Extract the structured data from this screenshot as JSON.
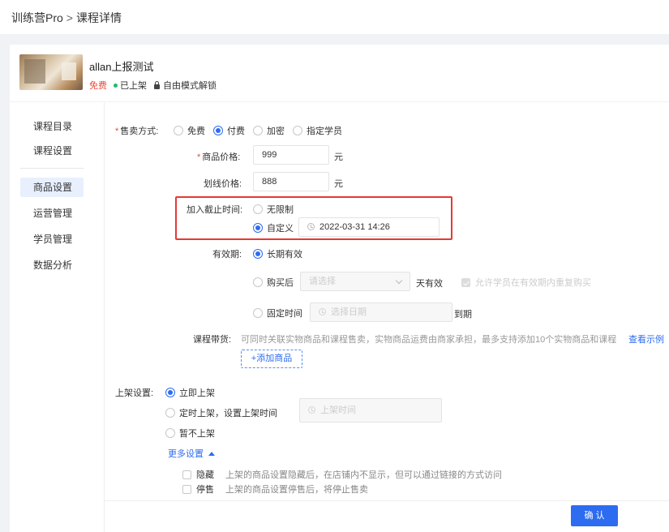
{
  "breadcrumb": {
    "root": "训练营Pro",
    "separator": ">",
    "current": "课程详情"
  },
  "course": {
    "title": "allan上报测试",
    "price_tag": "免费",
    "status": "已上架",
    "lock_mode": "自由模式解锁"
  },
  "sidebar": {
    "items": [
      {
        "label": "课程目录"
      },
      {
        "label": "课程设置"
      },
      {
        "label": "商品设置"
      },
      {
        "label": "运营管理"
      },
      {
        "label": "学员管理"
      },
      {
        "label": "数据分析"
      }
    ],
    "active": "商品设置"
  },
  "sale_method": {
    "label": "售卖方式:",
    "options": [
      {
        "label": "免费",
        "checked": false
      },
      {
        "label": "付费",
        "checked": true
      },
      {
        "label": "加密",
        "checked": false
      },
      {
        "label": "指定学员",
        "checked": false
      }
    ]
  },
  "price": {
    "label": "商品价格:",
    "value": "999",
    "unit": "元"
  },
  "strike_price": {
    "label": "划线价格:",
    "value": "888",
    "unit": "元"
  },
  "join_deadline": {
    "label": "加入截止时间:",
    "option_unlimited": "无限制",
    "option_custom": "自定义",
    "datetime": "2022-03-31 14:26"
  },
  "validity": {
    "label": "有效期:",
    "option_long_term": "长期有效",
    "option_after_purchase": "购买后",
    "select_placeholder": "请选择",
    "days_suffix": "天有效",
    "allow_repurchase": "允许学员在有效期内重复购买",
    "option_fixed_time": "固定时间",
    "date_placeholder": "选择日期",
    "expire_suffix": "到期"
  },
  "bundle": {
    "label": "课程带货:",
    "description": "可同时关联实物商品和课程售卖，实物商品运费由商家承担，最多支持添加10个实物商品和课程",
    "example_link": "查看示例",
    "add_button": "+添加商品"
  },
  "listing": {
    "label": "上架设置:",
    "option_now": "立即上架",
    "option_scheduled": "定时上架，设置上架时间",
    "time_placeholder": "上架时间",
    "option_not_now": "暂不上架",
    "more_settings": "更多设置",
    "hide": {
      "label": "隐藏",
      "desc": "上架的商品设置隐藏后，在店铺内不显示，但可以通过链接的方式访问"
    },
    "stop": {
      "label": "停售",
      "desc": "上架的商品设置停售后，将停止售卖"
    }
  },
  "footer": {
    "confirm": "确 认"
  },
  "colors": {
    "primary": "#2d6cf0",
    "danger": "#e53935",
    "success": "#19be6b",
    "free_tag": "#e94b3c"
  }
}
